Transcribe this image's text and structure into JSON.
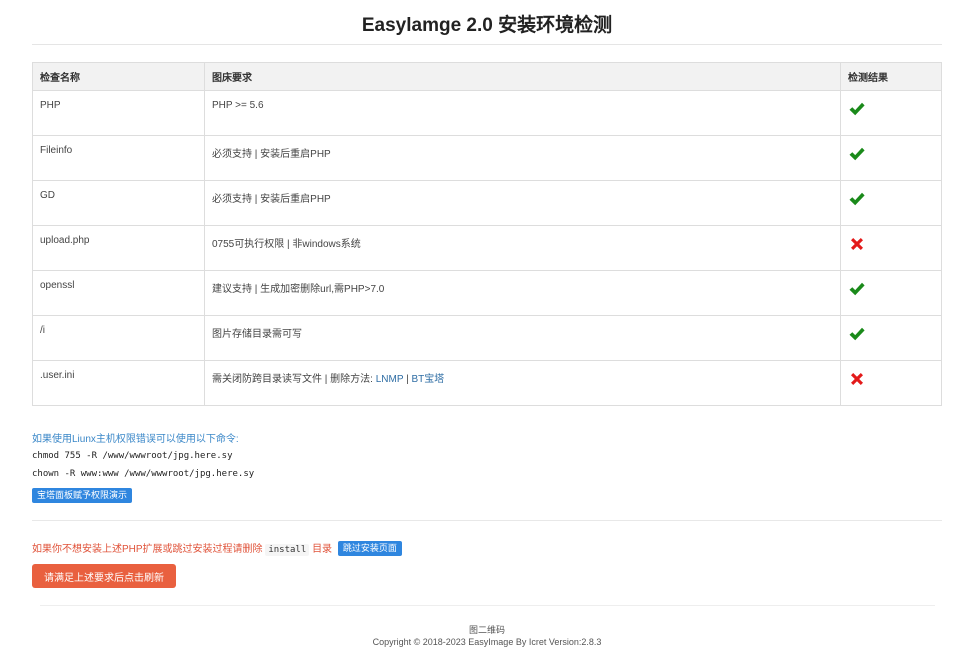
{
  "page": {
    "title": "Easylamge 2.0 安装环境检测"
  },
  "table": {
    "headers": [
      "检查名称",
      "图床要求",
      "检测结果"
    ],
    "rows": [
      {
        "name": "PHP",
        "requirement": "PHP >= 5.6",
        "result": "pass"
      },
      {
        "name": "Fileinfo",
        "requirement": "必须支持 | 安装后重启PHP",
        "result": "pass"
      },
      {
        "name": "GD",
        "requirement": "必须支持 | 安装后重启PHP",
        "result": "pass"
      },
      {
        "name": "upload.php",
        "requirement": "0755可执行权限 | 非windows系统",
        "result": "fail"
      },
      {
        "name": "openssl",
        "requirement": "建议支持 | 生成加密删除url,需PHP>7.0",
        "result": "pass"
      },
      {
        "name": "/i",
        "requirement": "图片存储目录需可写",
        "result": "pass"
      },
      {
        "name": ".user.ini",
        "requirement": "需关闭防跨目录读写文件 | 删除方法: ",
        "result": "fail",
        "links": [
          {
            "label": "LNMP"
          },
          {
            "separator": " | "
          },
          {
            "label": "BT宝塔"
          }
        ]
      }
    ]
  },
  "colors": {
    "pass": "#1a8a1a",
    "fail": "#e31a1a",
    "blue_button": "#2f86df",
    "red_button": "#e9603f"
  },
  "icons": {
    "pass": "check-icon",
    "fail": "cross-icon"
  },
  "permission_help": {
    "note": "如果使用Liunx主机权限错误可以使用以下命令:",
    "commands": [
      "chmod 755 -R /www/wwwroot/jpg.here.sy",
      "chown -R www:www /www/wwwroot/jpg.here.sy"
    ],
    "demo_button": "宝塔面板赋予权限演示"
  },
  "skip": {
    "text": "如果你不想安装上述PHP扩展或跳过安装过程请删除",
    "code": "install",
    "suffix": "目录",
    "button": "跳过安装页面"
  },
  "refresh_button": "请满足上述要求后点击刷新",
  "footer": {
    "qr_label": "图二维码",
    "copyright": "Copyright © 2018-2023 EasyImage By Icret Version:2.8.3"
  }
}
